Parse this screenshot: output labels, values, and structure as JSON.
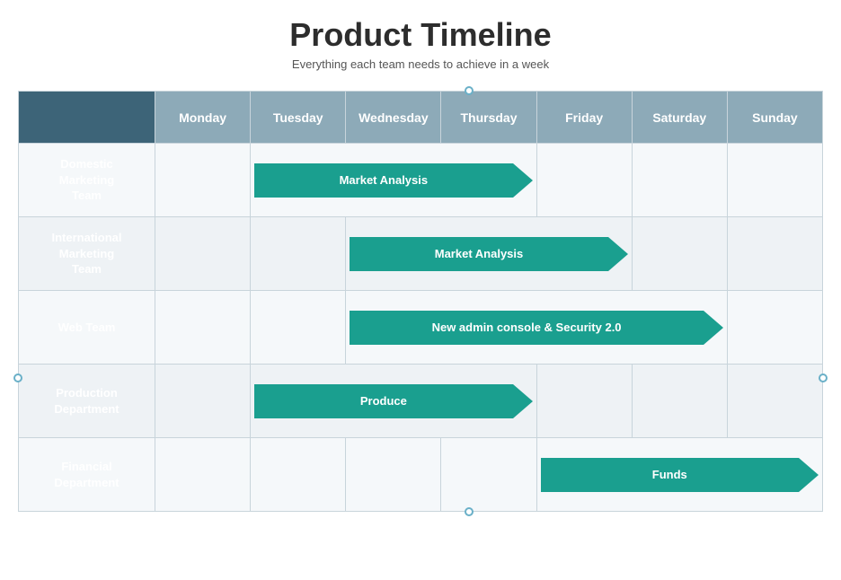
{
  "title": "Product Timeline",
  "subtitle": "Everything each team needs to achieve in a week",
  "days": [
    "Monday",
    "Tuesday",
    "Wednesday",
    "Thursday",
    "Friday",
    "Saturday",
    "Sunday"
  ],
  "teams": [
    {
      "name": "Domestic\nMarketing\nTeam",
      "task": "Market Analysis",
      "startDay": 1,
      "spanDays": 3
    },
    {
      "name": "International\nMarketing\nTeam",
      "task": "Market Analysis",
      "startDay": 2,
      "spanDays": 3
    },
    {
      "name": "Web Team",
      "task": "New admin console & Security 2.0",
      "startDay": 2,
      "spanDays": 4
    },
    {
      "name": "Production\nDepartment",
      "task": "Produce",
      "startDay": 1,
      "spanDays": 3
    },
    {
      "name": "Financial\nDepartment",
      "task": "Funds",
      "startDay": 4,
      "spanDays": 3
    }
  ]
}
